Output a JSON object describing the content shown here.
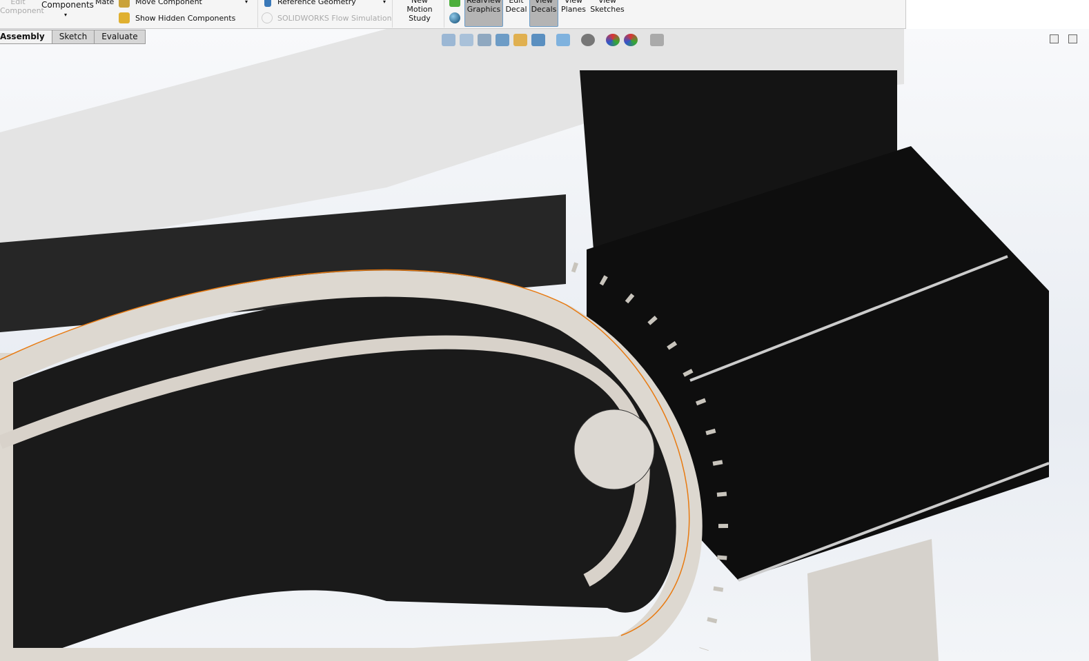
{
  "ribbon": {
    "edit_component": "Edit\nComponent",
    "components": "Components",
    "mate": "Mate",
    "move_component": "Move Component",
    "show_hidden": "Show Hidden Components",
    "reference_geometry": "Reference Geometry",
    "flow_sim": "SOLIDWORKS Flow Simulation",
    "new_motion": "New\nMotion\nStudy",
    "realview": "RealView\nGraphics",
    "edit_decal": "Edit\nDecal",
    "view_decals": "View\nDecals",
    "view_planes": "View\nPlanes",
    "view_sketches": "View\nSketches"
  },
  "tabs": [
    "Assembly",
    "Sketch",
    "Evaluate"
  ],
  "heads_up_icons": [
    "zoom-to-fit-icon",
    "zoom-to-area-icon",
    "previous-view-icon",
    "section-view-icon",
    "dynamic-annotation-icon",
    "view-orientation-icon",
    "display-style-icon",
    "hide-show-items-icon",
    "edit-appearance-icon",
    "apply-scene-icon",
    "view-settings-icon"
  ],
  "colors": {
    "accent": "#6a9cc8",
    "selection": "#e87a10",
    "model_dark": "#1e1e1e",
    "model_light": "#ddd8d0"
  }
}
